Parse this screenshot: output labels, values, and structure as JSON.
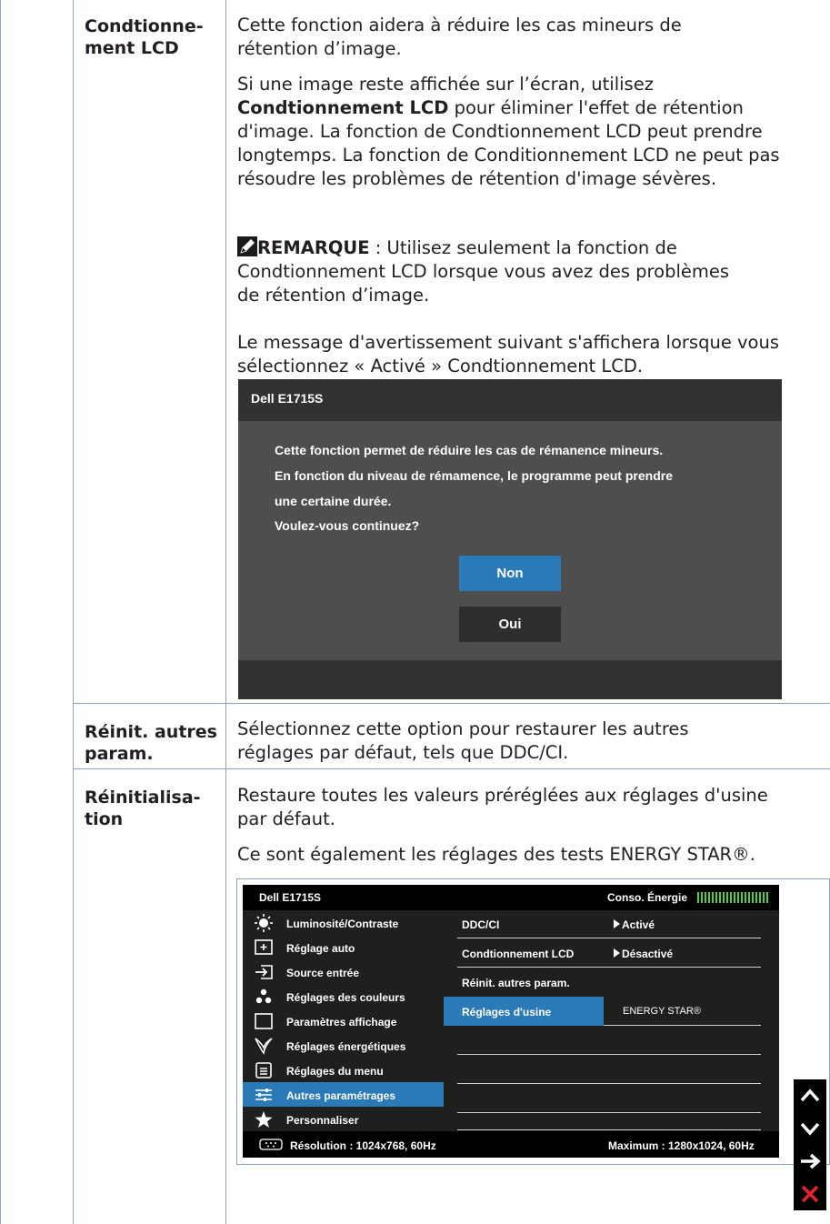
{
  "rows": [
    {
      "label": "Condtionne-\nment LCD",
      "para1": "Cette fonction aidera à réduire les cas mineurs de rétention d’image.",
      "para2_pre": "Si une image reste affichée sur l’écran, utilisez",
      "para2_bold": "Condtionnement LCD",
      "para2_post": "pour éliminer l'effet de rétention d'image. La fonction de Condtionnement LCD peut prendre longtemps. La fonction de Conditionnement LCD ne peut pas résoudre les problèmes de rétention d'image sévères.",
      "note_label": "REMARQUE",
      "note_text": " : Utilisez seulement la fonction de Condtionnement LCD lorsque vous avez des problèmes de rétention d’image.",
      "para3": "Le message d'avertissement suivant s'affichera lorsque vous sélectionnez « Activé » Condtionnement LCD."
    },
    {
      "label": "Réinit. autres param.",
      "text": "Sélectionnez cette option pour restaurer les autres réglages par défaut, tels que DDC/CI."
    },
    {
      "label": "Réinitialisa-\ntion",
      "para1": "Restaure toutes les valeurs préréglées aux réglages d'usine par défaut.",
      "para2": "Ce sont également les réglages des tests ENERGY STAR®."
    }
  ],
  "dialog": {
    "title": "Dell E1715S",
    "lines": [
      "Cette fonction permet de réduire les cas de rémanence mineurs.",
      "En fonction du niveau de rémamence, le programme peut prendre",
      "une certaine durée.",
      "Voulez-vous continuez?"
    ],
    "btn_no": "Non",
    "btn_yes": "Oui",
    "btn_no_color": "#2a7ab8",
    "btn_yes_color": "#2e2e2e"
  },
  "osd": {
    "title": "Dell E1715S",
    "energy_label": "Conso. Énergie",
    "menu": [
      {
        "label": "Luminosité/Contraste",
        "icon": "brightness-icon"
      },
      {
        "label": "Réglage auto",
        "icon": "auto-adjust-icon"
      },
      {
        "label": "Source entrée",
        "icon": "input-source-icon"
      },
      {
        "label": "Réglages des couleurs",
        "icon": "color-icon"
      },
      {
        "label": "Paramètres affichage",
        "icon": "display-icon"
      },
      {
        "label": "Réglages énergétiques",
        "icon": "energy-icon"
      },
      {
        "label": "Réglages du menu",
        "icon": "menu-icon"
      },
      {
        "label": "Autres paramétrages",
        "icon": "other-settings-icon",
        "selected": true
      },
      {
        "label": "Personnaliser",
        "icon": "star-icon"
      }
    ],
    "submenu": [
      {
        "label": "DDC/CI",
        "value": "Activé"
      },
      {
        "label": "Condtionnement LCD",
        "value": "Désactivé"
      },
      {
        "label": "Réinit. autres param.",
        "value": ""
      },
      {
        "label": "Réglages d'usine",
        "value": "ENERGY STAR®",
        "selected": true
      }
    ],
    "resolution": "Résolution : 1024x768, 60Hz",
    "maximum": "Maximum : 1280x1024, 60Hz",
    "accent": "#2a7ab8",
    "energy_bar_color": "#4cd23a"
  },
  "nav": {
    "up": "⌃",
    "down": "⌄",
    "right": "→",
    "close": "✕"
  }
}
